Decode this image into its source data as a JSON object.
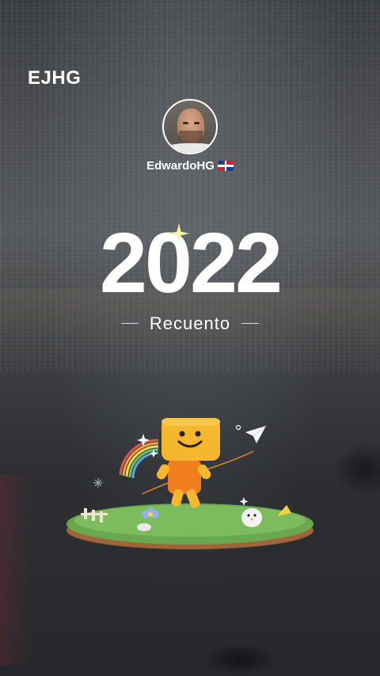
{
  "header": {
    "brand": "EJHG"
  },
  "profile": {
    "username": "EdwardoHG",
    "flag_icon": "dominican-republic-flag-icon"
  },
  "hero": {
    "year": "2022",
    "subtitle": "Recuento"
  },
  "colors": {
    "text": "#ffffff",
    "mascot_head": "#f5b72e",
    "mascot_body": "#f27f1d",
    "grass": "#6aa84f"
  }
}
